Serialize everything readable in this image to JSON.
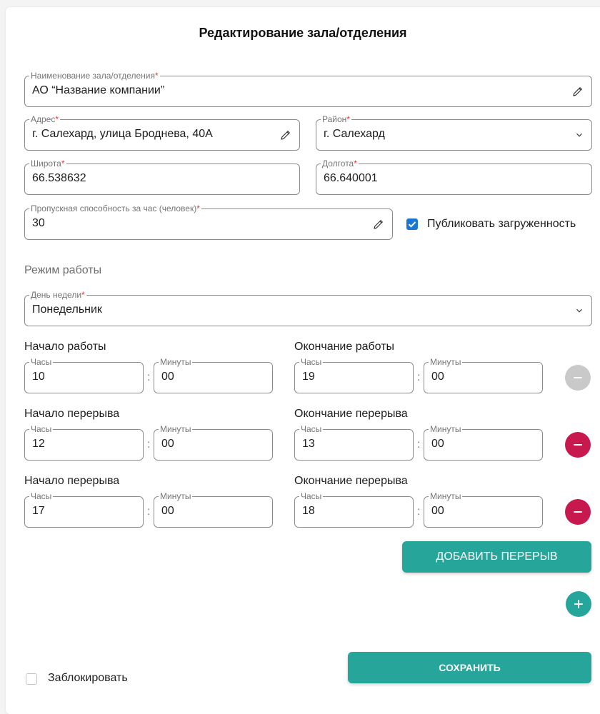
{
  "form": {
    "title": "Редактирование зала/отделения",
    "name": {
      "label": "Наименование зала/отделения",
      "value": "АО “Название компании”"
    },
    "address": {
      "label": "Адрес",
      "value": "г. Салехард, улица Броднева, 40А"
    },
    "district": {
      "label": "Район",
      "value": "г. Салехард"
    },
    "latitude": {
      "label": "Широта",
      "value": "66.538632"
    },
    "longitude": {
      "label": "Долгота",
      "value": "66.640001"
    },
    "capacity": {
      "label": "Пропускная способность за час (человек)",
      "value": "30"
    },
    "publish_load": {
      "label": "Публиковать загруженность",
      "checked": true
    },
    "required_mark": "*"
  },
  "schedule": {
    "section_title": "Режим работы",
    "weekday": {
      "label": "День недели",
      "value": "Понедельник"
    },
    "hours_label": "Часы",
    "minutes_label": "Минуты",
    "colon": ":",
    "rows": [
      {
        "start_label": "Начало работы",
        "end_label": "Окончание работы",
        "start_h": "10",
        "start_m": "00",
        "end_h": "19",
        "end_m": "00",
        "remove_enabled": false
      },
      {
        "start_label": "Начало перерыва",
        "end_label": "Окончание перерыва",
        "start_h": "12",
        "start_m": "00",
        "end_h": "13",
        "end_m": "00",
        "remove_enabled": true
      },
      {
        "start_label": "Начало перерыва",
        "end_label": "Окончание перерыва",
        "start_h": "17",
        "start_m": "00",
        "end_h": "18",
        "end_m": "00",
        "remove_enabled": true
      }
    ],
    "add_break_label": "ДОБАВИТЬ ПЕРЕРЫВ"
  },
  "footer": {
    "block_label": "Заблокировать",
    "block_checked": false,
    "save_label": "СОХРАНИТЬ"
  },
  "colors": {
    "accent": "#26a69a",
    "danger": "#c8194f",
    "disabled": "#c9c9c9",
    "checkbox": "#1976d2",
    "required": "#e53935"
  },
  "icons": {
    "edit": "pencil-icon",
    "dropdown": "chevron-down-icon",
    "remove": "minus-icon",
    "add": "plus-icon",
    "check": "check-icon"
  }
}
